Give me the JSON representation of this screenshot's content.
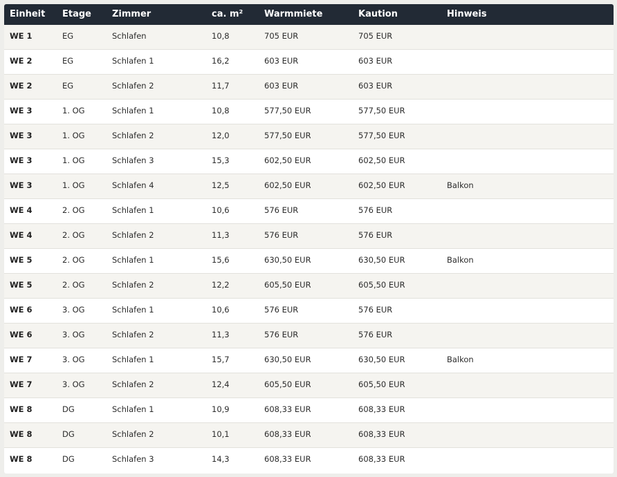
{
  "table": {
    "headers": [
      "Einheit",
      "Etage",
      "Zimmer",
      "ca. m²",
      "Warmmiete",
      "Kaution",
      "Hinweis"
    ],
    "rows": [
      [
        "WE 1",
        "EG",
        "Schlafen",
        "10,8",
        "705 EUR",
        "705 EUR",
        ""
      ],
      [
        "WE 2",
        "EG",
        "Schlafen 1",
        "16,2",
        "603 EUR",
        "603 EUR",
        ""
      ],
      [
        "WE 2",
        "EG",
        "Schlafen 2",
        "11,7",
        "603 EUR",
        "603 EUR",
        ""
      ],
      [
        "WE 3",
        "1. OG",
        "Schlafen 1",
        "10,8",
        "577,50 EUR",
        "577,50 EUR",
        ""
      ],
      [
        "WE 3",
        "1. OG",
        "Schlafen 2",
        "12,0",
        "577,50 EUR",
        "577,50 EUR",
        ""
      ],
      [
        "WE 3",
        "1. OG",
        "Schlafen 3",
        "15,3",
        "602,50 EUR",
        "602,50 EUR",
        ""
      ],
      [
        "WE 3",
        "1. OG",
        "Schlafen 4",
        "12,5",
        "602,50 EUR",
        "602,50 EUR",
        "Balkon"
      ],
      [
        "WE 4",
        "2. OG",
        "Schlafen 1",
        "10,6",
        "576 EUR",
        "576 EUR",
        ""
      ],
      [
        "WE 4",
        "2. OG",
        "Schlafen 2",
        "11,3",
        "576 EUR",
        "576 EUR",
        ""
      ],
      [
        "WE 5",
        "2. OG",
        "Schlafen 1",
        "15,6",
        "630,50 EUR",
        "630,50 EUR",
        "Balkon"
      ],
      [
        "WE 5",
        "2. OG",
        "Schlafen 2",
        "12,2",
        "605,50 EUR",
        "605,50 EUR",
        ""
      ],
      [
        "WE 6",
        "3. OG",
        "Schlafen 1",
        "10,6",
        "576 EUR",
        "576 EUR",
        ""
      ],
      [
        "WE 6",
        "3. OG",
        "Schlafen 2",
        "11,3",
        "576 EUR",
        "576 EUR",
        ""
      ],
      [
        "WE 7",
        "3. OG",
        "Schlafen 1",
        "15,7",
        "630,50 EUR",
        "630,50 EUR",
        "Balkon"
      ],
      [
        "WE 7",
        "3. OG",
        "Schlafen 2",
        "12,4",
        "605,50 EUR",
        "605,50 EUR",
        ""
      ],
      [
        "WE 8",
        "DG",
        "Schlafen 1",
        "10,9",
        "608,33 EUR",
        "608,33 EUR",
        ""
      ],
      [
        "WE 8",
        "DG",
        "Schlafen 2",
        "10,1",
        "608,33 EUR",
        "608,33 EUR",
        ""
      ],
      [
        "WE 8",
        "DG",
        "Schlafen 3",
        "14,3",
        "608,33 EUR",
        "608,33 EUR",
        ""
      ]
    ]
  },
  "colors": {
    "header_bg": "#222a35",
    "row_alt_bg": "#f5f4f0",
    "row_bg": "#ffffff",
    "page_bg": "#eeeeeb"
  }
}
